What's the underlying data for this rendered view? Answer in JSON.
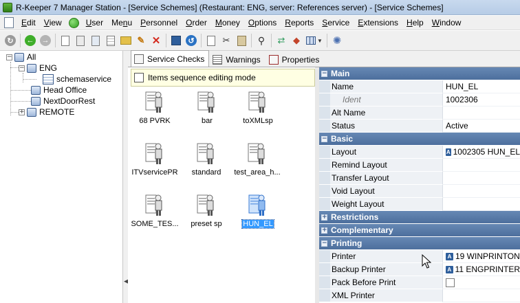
{
  "window": {
    "title": "R-Keeper 7 Manager Station - [Service Schemes] (Restaurant: ENG, server: References server) - [Service Schemes]"
  },
  "menu": [
    {
      "pre": "",
      "u": "E",
      "post": "dit"
    },
    {
      "pre": "",
      "u": "V",
      "post": "iew"
    },
    {
      "pre": "",
      "u": "U",
      "post": "ser"
    },
    {
      "pre": "Me",
      "u": "n",
      "post": "u"
    },
    {
      "pre": "",
      "u": "P",
      "post": "ersonnel"
    },
    {
      "pre": "",
      "u": "O",
      "post": "rder"
    },
    {
      "pre": "",
      "u": "M",
      "post": "oney"
    },
    {
      "pre": "",
      "u": "O",
      "post": "ptions"
    },
    {
      "pre": "",
      "u": "R",
      "post": "eports"
    },
    {
      "pre": "",
      "u": "S",
      "post": "ervice"
    },
    {
      "pre": "",
      "u": "E",
      "post": "xtensions"
    },
    {
      "pre": "",
      "u": "H",
      "post": "elp"
    },
    {
      "pre": "",
      "u": "W",
      "post": "indow"
    }
  ],
  "tree": {
    "root": "All",
    "eng": "ENG",
    "schema": "schemaservice",
    "head_office": "Head Office",
    "next_door": "NextDoorRest",
    "remote": "REMOTE"
  },
  "tabs": [
    "Service Checks",
    "Warnings",
    "Properties"
  ],
  "notice": "Items sequence editing mode",
  "items": [
    "68 PVRK",
    "bar",
    "toXMLsp",
    "ITVservicePR",
    "standard",
    "test_area_h...",
    "SOME_TES...",
    "preset sp",
    "HUN_EL"
  ],
  "properties": {
    "main": {
      "title": "Main",
      "name_label": "Name",
      "name_value": "HUN_EL",
      "ident_label": "Ident",
      "ident_value": "1002306",
      "alt_label": "Alt Name",
      "alt_value": "",
      "status_label": "Status",
      "status_value": "Active"
    },
    "basic": {
      "title": "Basic",
      "layout_label": "Layout",
      "layout_value": "1002305 HUN_EL",
      "remind_label": "Remind Layout",
      "transfer_label": "Transfer Layout",
      "void_label": "Void Layout",
      "weight_label": "Weight Layout"
    },
    "restrictions": "Restrictions",
    "complementary": "Complementary",
    "printing": {
      "title": "Printing",
      "printer_label": "Printer",
      "printer_value": "19 WINPRINTON",
      "backup_label": "Backup Printer",
      "backup_value": "11 ENGPRINTER",
      "pack_label": "Pack Before Print",
      "xml_label": "XML Printer"
    }
  },
  "colors": {
    "section": "#4d6f9d",
    "selection": "#3399ff",
    "notice_bg": "#ffffe3"
  },
  "icons": [
    "app-icon",
    "document-icon",
    "green-status-icon",
    "refresh-icon",
    "back-icon",
    "forward-icon",
    "folder-icon",
    "delete-icon",
    "checks-icon",
    "warnings-icon",
    "properties-icon",
    "cook-icon",
    "mouse-cursor-icon"
  ]
}
